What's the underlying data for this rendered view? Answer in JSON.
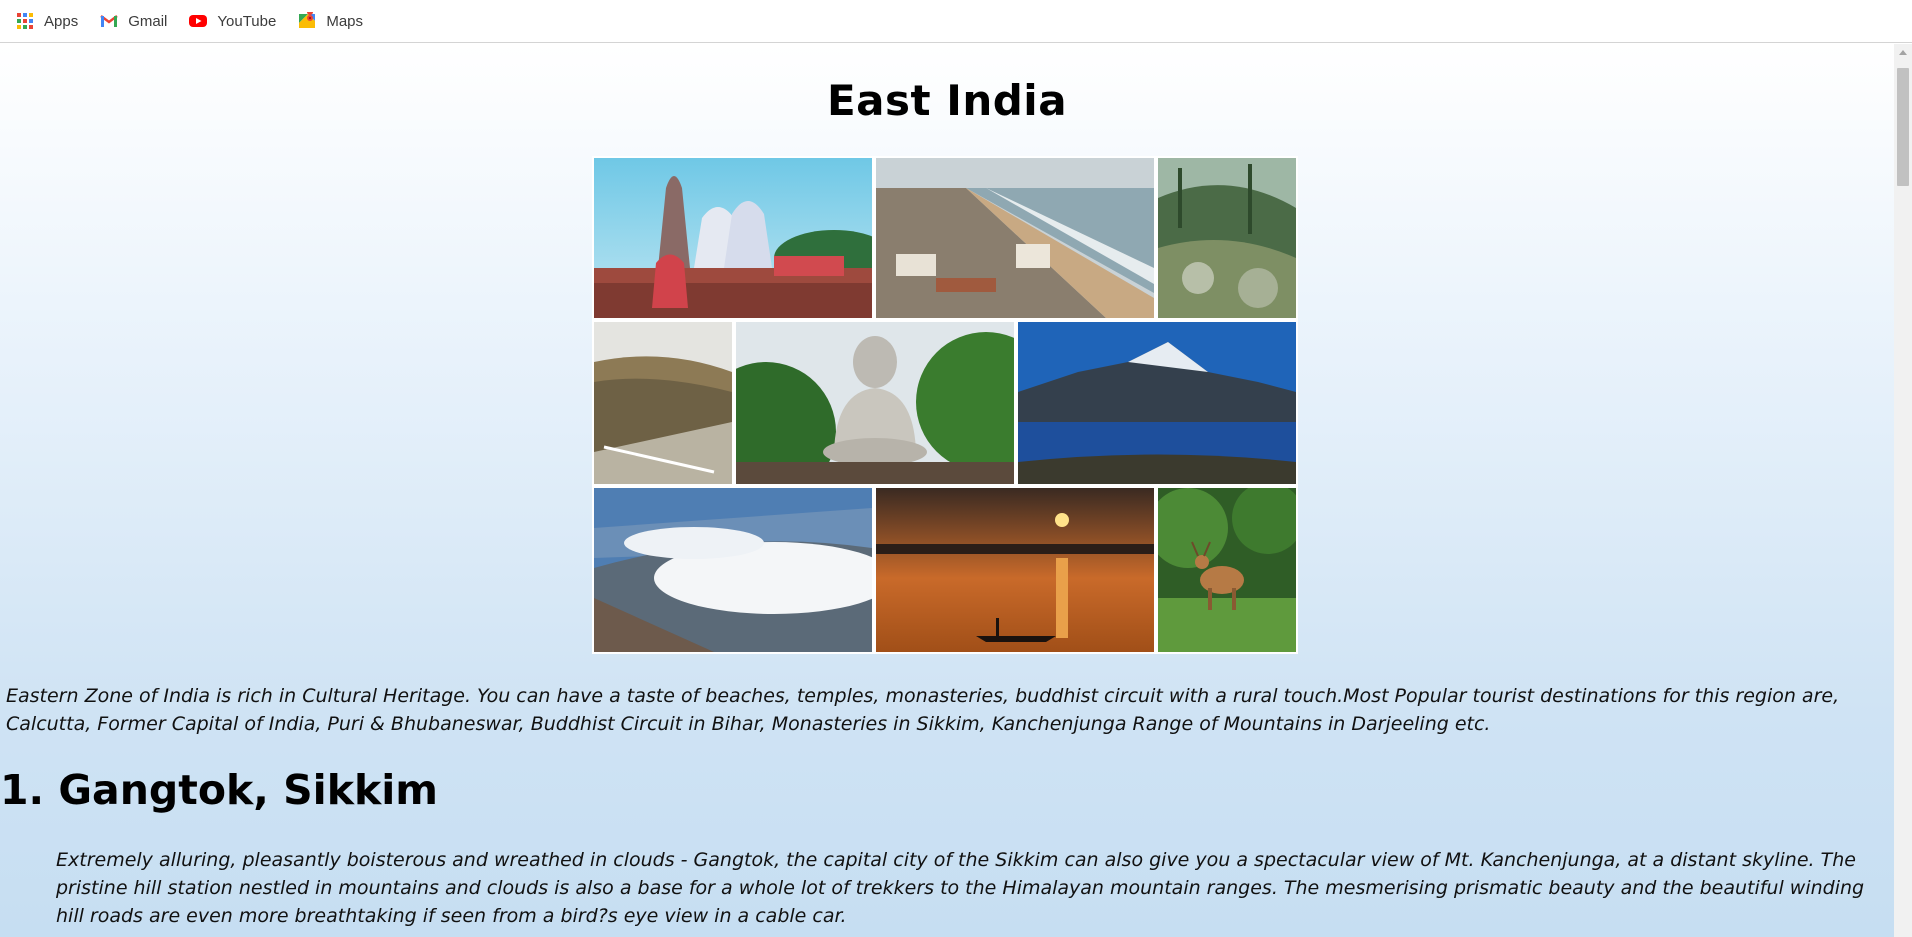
{
  "bookmarks": [
    {
      "label": "Apps",
      "icon": "apps-grid-icon"
    },
    {
      "label": "Gmail",
      "icon": "gmail-icon"
    },
    {
      "label": "YouTube",
      "icon": "youtube-icon"
    },
    {
      "label": "Maps",
      "icon": "maps-icon"
    }
  ],
  "page": {
    "title": "East India",
    "intro": "Eastern Zone of India is rich in Cultural Heritage. You can have a taste of beaches, temples, monasteries, buddhist circuit with a rural touch.Most Popular tourist destinations for this region are, Calcutta, Former Capital of India, Puri & Bhubaneswar, Buddhist Circuit in Bihar, Monasteries in Sikkim, Kanchenjunga Range of Mountains in Darjeeling etc.",
    "sections": [
      {
        "number": "1.",
        "heading": "Gangtok, Sikkim",
        "text": "Extremely alluring, pleasantly boisterous and wreathed in clouds - Gangtok, the capital city of the Sikkim can also give you a spectacular view of Mt. Kanchenjunga, at a distant skyline. The pristine hill station nestled in mountains and clouds is also a base for a whole lot of trekkers to the Himalayan mountain ranges. The mesmerising prismatic beauty and the beautiful winding hill roads are even more breathtaking if seen from a bird?s eye view in a cable car."
      }
    ]
  },
  "collage": {
    "images": [
      {
        "subject": "temple"
      },
      {
        "subject": "beach town"
      },
      {
        "subject": "forest hill"
      },
      {
        "subject": "hill path"
      },
      {
        "subject": "buddha statue"
      },
      {
        "subject": "mountain lake"
      },
      {
        "subject": "clouds over hill town"
      },
      {
        "subject": "river sunset"
      },
      {
        "subject": "deer in forest"
      }
    ]
  },
  "colors": {
    "background_top": "#ffffff",
    "background_bottom": "#c6def2",
    "text": "#000000"
  }
}
